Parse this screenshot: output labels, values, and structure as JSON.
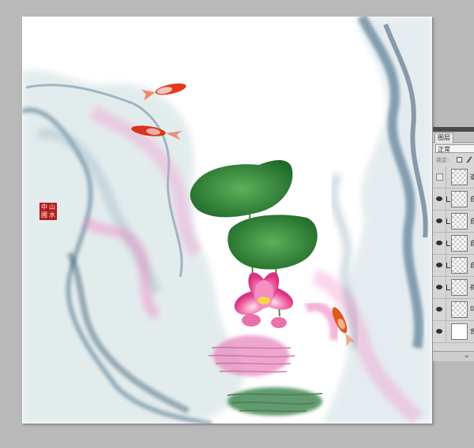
{
  "canvas": {
    "seal_text": [
      "中",
      "山",
      "國",
      "水"
    ]
  },
  "layers_panel": {
    "tab_label": "图层",
    "blend_mode": "正常",
    "lock_label": "锁定:",
    "footer_icon": "link-icon",
    "layers": [
      {
        "name_fragment": "道",
        "visible": false,
        "clipped": false,
        "thumb": "checker"
      },
      {
        "name_fragment": "自",
        "visible": true,
        "clipped": true,
        "thumb": "checker"
      },
      {
        "name_fragment": "自",
        "visible": true,
        "clipped": true,
        "thumb": "checker"
      },
      {
        "name_fragment": "自",
        "visible": true,
        "clipped": true,
        "thumb": "checker"
      },
      {
        "name_fragment": "自",
        "visible": true,
        "clipped": true,
        "thumb": "checker"
      },
      {
        "name_fragment": "荷",
        "visible": true,
        "clipped": true,
        "thumb": "checker"
      },
      {
        "name_fragment": "0",
        "visible": true,
        "clipped": false,
        "thumb": "checker"
      },
      {
        "name_fragment": "背",
        "visible": true,
        "clipped": false,
        "thumb": "solid"
      }
    ]
  }
}
